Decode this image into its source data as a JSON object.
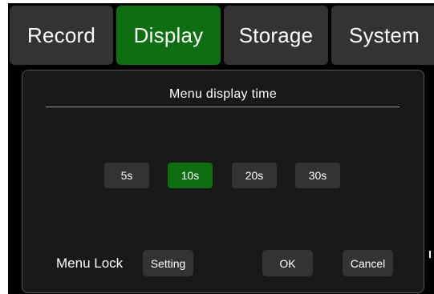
{
  "tabs": [
    {
      "label": "Record",
      "active": false
    },
    {
      "label": "Display",
      "active": true
    },
    {
      "label": "Storage",
      "active": false
    },
    {
      "label": "System",
      "active": false
    }
  ],
  "dialog": {
    "title": "Menu display time",
    "options": [
      {
        "label": "5s",
        "selected": false
      },
      {
        "label": "10s",
        "selected": true
      },
      {
        "label": "20s",
        "selected": false
      },
      {
        "label": "30s",
        "selected": false
      }
    ],
    "menu_lock_label": "Menu Lock",
    "setting_label": "Setting",
    "ok_label": "OK",
    "cancel_label": "Cancel"
  },
  "colors": {
    "screen_background": "#000000",
    "panel_background": "#191919",
    "button_background": "#333333",
    "accent_green": "#0e6e12",
    "text": "#ffffff"
  }
}
